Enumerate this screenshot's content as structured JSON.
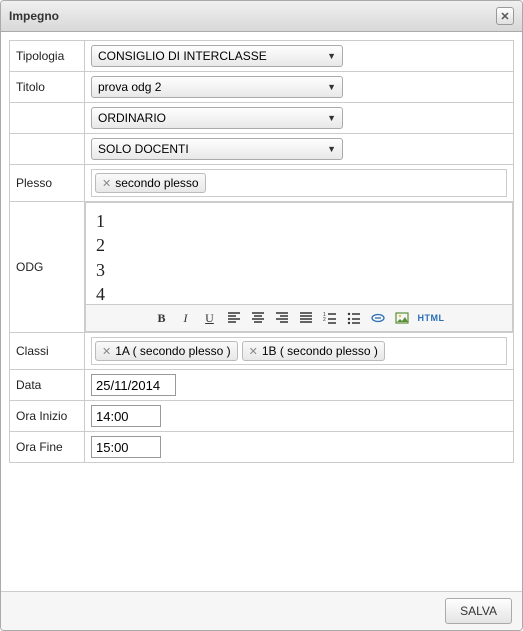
{
  "dialog": {
    "title": "Impegno",
    "closeGlyph": "✕"
  },
  "labels": {
    "tipologia": "Tipologia",
    "titolo": "Titolo",
    "plesso": "Plesso",
    "odg": "ODG",
    "classi": "Classi",
    "data": "Data",
    "oraInizio": "Ora Inizio",
    "oraFine": "Ora Fine"
  },
  "selects": {
    "tipologia": "CONSIGLIO DI INTERCLASSE",
    "titolo": "prova odg 2",
    "modo": "ORDINARIO",
    "partecipanti": "SOLO DOCENTI"
  },
  "plessoTags": [
    "secondo plesso"
  ],
  "odgLines": [
    "1",
    "2",
    "3",
    "4"
  ],
  "classiTags": [
    "1A ( secondo plesso )",
    "1B ( secondo plesso )"
  ],
  "fields": {
    "data": "25/11/2014",
    "oraInizio": "14:00",
    "oraFine": "15:00"
  },
  "toolbar": {
    "bold": "B",
    "italic": "I",
    "underline": "U",
    "html": "HTML"
  },
  "footer": {
    "salva": "SALVA"
  },
  "tagX": "✕"
}
